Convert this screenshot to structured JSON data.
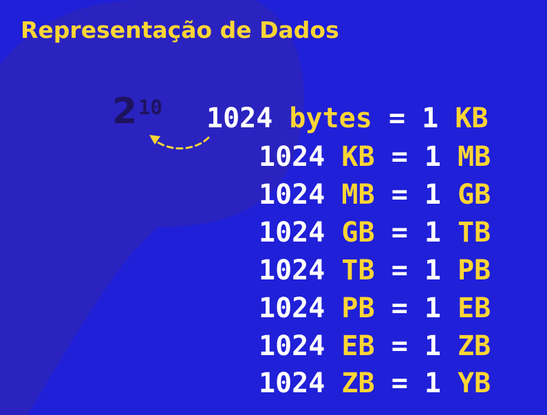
{
  "title": "Representação de Dados",
  "power": {
    "base": "2",
    "exponent": "10"
  },
  "rows": [
    {
      "number": "1024",
      "unit": "bytes",
      "equals": "=",
      "one": "1",
      "result": "KB"
    },
    {
      "number": "1024",
      "unit": "KB",
      "equals": "=",
      "one": "1",
      "result": "MB"
    },
    {
      "number": "1024",
      "unit": "MB",
      "equals": "=",
      "one": "1",
      "result": "GB"
    },
    {
      "number": "1024",
      "unit": "GB",
      "equals": "=",
      "one": "1",
      "result": "TB"
    },
    {
      "number": "1024",
      "unit": "TB",
      "equals": "=",
      "one": "1",
      "result": "PB"
    },
    {
      "number": "1024",
      "unit": "PB",
      "equals": "=",
      "one": "1",
      "result": "EB"
    },
    {
      "number": "1024",
      "unit": "EB",
      "equals": "=",
      "one": "1",
      "result": "ZB"
    },
    {
      "number": "1024",
      "unit": "ZB",
      "equals": "=",
      "one": "1",
      "result": "YB"
    }
  ],
  "colors": {
    "background": "#2020d8",
    "shape": "#2a23bf",
    "accent": "#fdd535",
    "text": "#ffffff",
    "power": "#1e135f"
  },
  "icons": {
    "arrow": "curved-dashed-arrow-icon"
  }
}
